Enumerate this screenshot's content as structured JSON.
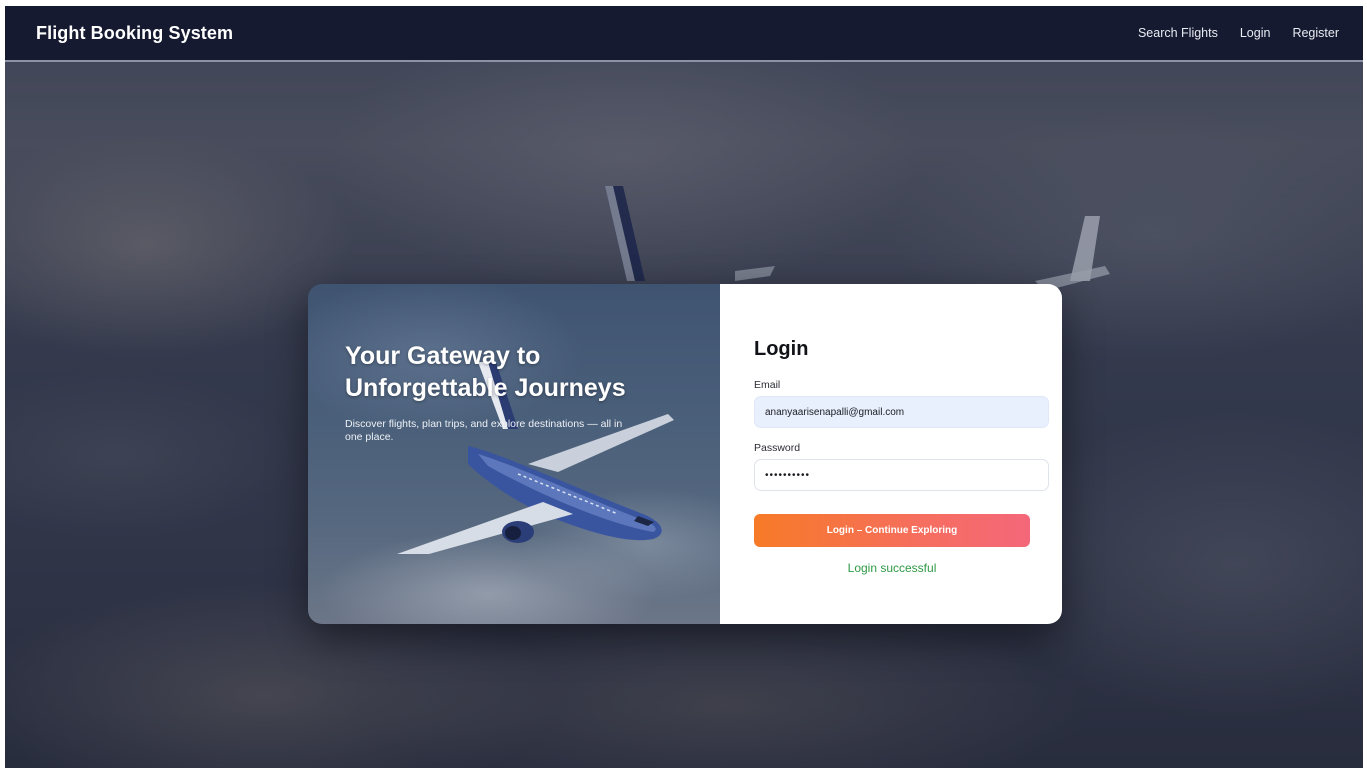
{
  "navbar": {
    "brand": "Flight Booking System",
    "links": [
      "Search Flights",
      "Login",
      "Register"
    ]
  },
  "hero": {
    "title_line1": "Your Gateway to",
    "title_line2": "Unforgettable Journeys",
    "subtitle": "Discover flights, plan trips, and explore destinations — all in one place."
  },
  "login": {
    "title": "Login",
    "email_label": "Email",
    "email_value": "ananyaarisenapalli@gmail.com",
    "password_label": "Password",
    "password_value": "••••••••••",
    "submit_label": "Login – Continue Exploring",
    "status": "Login successful"
  },
  "colors": {
    "navbar_bg": "#151a30",
    "button_start": "#f77a27",
    "button_end": "#f4677a",
    "success": "#2e9a45"
  }
}
